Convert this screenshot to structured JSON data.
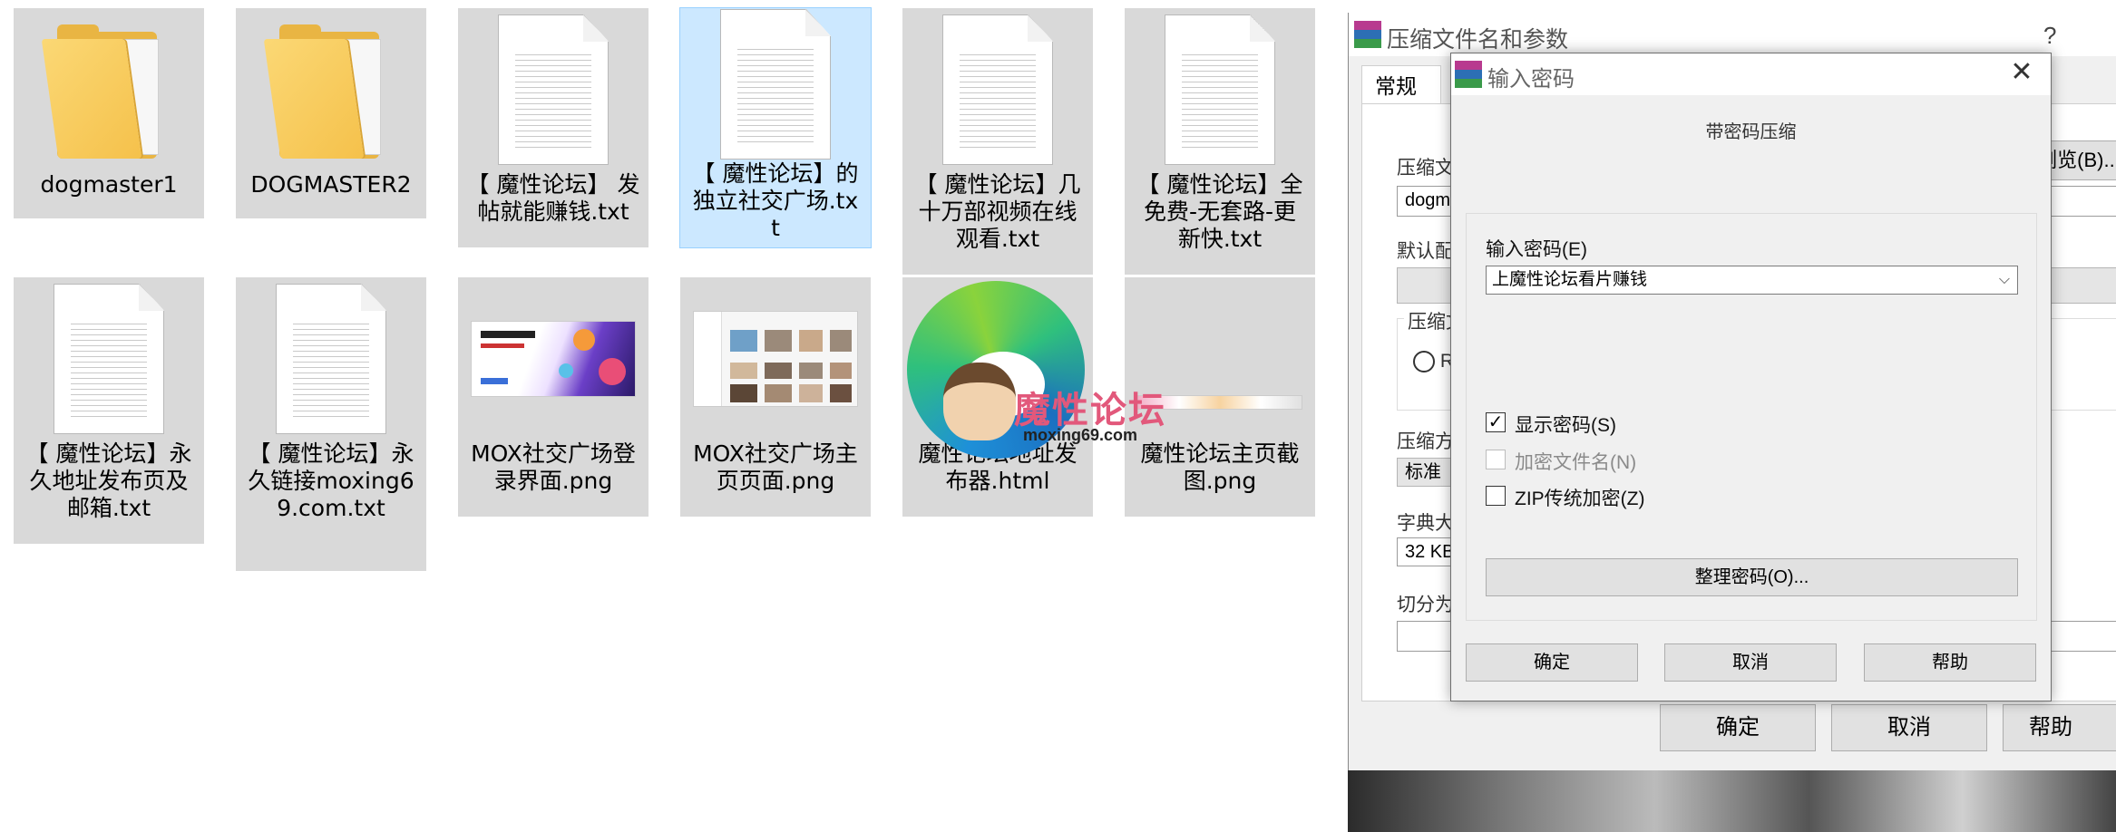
{
  "explorer": {
    "files": [
      {
        "name": "dogmaster1",
        "kind": "folder"
      },
      {
        "name": "DOGMASTER2",
        "kind": "folder"
      },
      {
        "name": "【 魔性论坛】 发帖就能赚钱.txt",
        "kind": "txt"
      },
      {
        "name": "【 魔性论坛】的独立社交广场.txt",
        "kind": "txt",
        "selected": true
      },
      {
        "name": "【 魔性论坛】几十万部视频在线观看.txt",
        "kind": "txt"
      },
      {
        "name": "【 魔性论坛】全免费-无套路-更新快.txt",
        "kind": "txt"
      },
      {
        "name": "【 魔性论坛】永久地址发布页及邮箱.txt",
        "kind": "txt"
      },
      {
        "name": "【 魔性论坛】永久链接moxing69.com.txt",
        "kind": "txt"
      },
      {
        "name": "MOX社交广场登录界面.png",
        "kind": "png"
      },
      {
        "name": "MOX社交广场主页页面.png",
        "kind": "png"
      },
      {
        "name": "魔性论坛地址发布器.html",
        "kind": "html"
      },
      {
        "name": "魔性论坛主页截图.png",
        "kind": "png"
      }
    ],
    "watermark": {
      "title": "魔性论坛",
      "url": "moxing69.com"
    }
  },
  "parent_dialog": {
    "title": "压缩文件名和参数",
    "help": "?",
    "tab": "常规",
    "archive_name_label": "压缩文",
    "archive_name_value": "dogm",
    "browse_label": "浏览(B)...",
    "default_profile_label": "默认配",
    "format_group_label": "压缩文",
    "format_option": "R",
    "method_label": "压缩方",
    "method_value": "标准",
    "dict_label": "字典大",
    "dict_value": "32 KB",
    "split_label": "切分为",
    "ok": "确定",
    "cancel": "取消",
    "help_button": "帮助"
  },
  "password_dialog": {
    "title": "输入密码",
    "heading": "带密码压缩",
    "password_label": "输入密码(E)",
    "password_value": "上魔性论坛看片赚钱",
    "show_password": {
      "label": "显示密码(S)",
      "checked": true
    },
    "encrypt_names": {
      "label": "加密文件名(N)",
      "checked": false,
      "disabled": true
    },
    "zip_legacy": {
      "label": "ZIP传统加密(Z)",
      "checked": false
    },
    "organize_button": "整理密码(O)...",
    "ok": "确定",
    "cancel": "取消",
    "help": "帮助",
    "check_mark": "✓",
    "close_glyph": "✕",
    "chevron_glyph": "⌵"
  }
}
